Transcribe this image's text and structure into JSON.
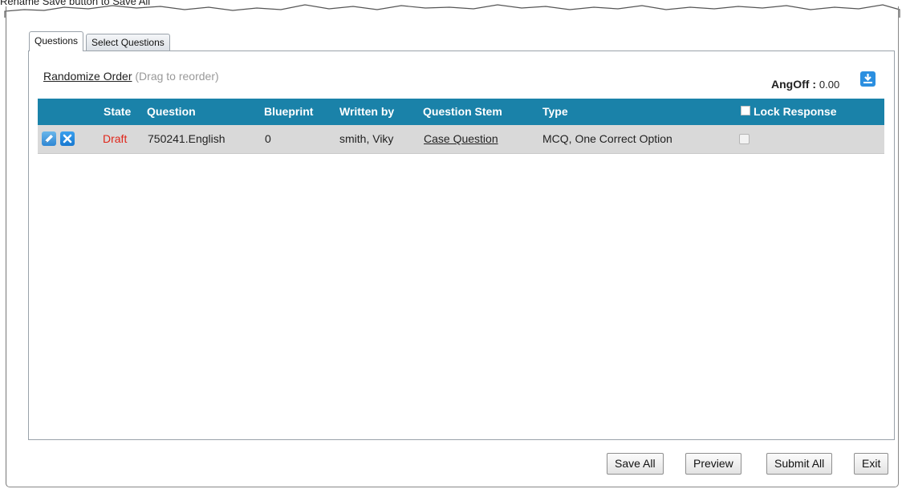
{
  "caption": "Rename Save button to Save All",
  "tabs": [
    {
      "label": "Questions",
      "active": true
    },
    {
      "label": "Select Questions",
      "active": false
    }
  ],
  "toolbar": {
    "randomize_label": "Randomize Order",
    "randomize_hint": "(Drag to reorder)",
    "angoff_label": "AngOff :",
    "angoff_value": "0.00"
  },
  "grid": {
    "columns": {
      "state": "State",
      "question": "Question",
      "blueprint": "Blueprint",
      "written_by": "Written by",
      "question_stem": "Question Stem",
      "type": "Type",
      "lock_response": "Lock Response"
    },
    "rows": [
      {
        "state": "Draft",
        "question": "750241.English",
        "blueprint": "0",
        "written_by": "smith, Viky",
        "question_stem": "Case Question",
        "type": "MCQ, One Correct Option",
        "lock_response": false
      }
    ]
  },
  "footer": {
    "save_all": "Save All",
    "preview": "Preview",
    "submit_all": "Submit All",
    "exit": "Exit"
  },
  "colors": {
    "header_bg": "#1a82a9",
    "row_bg": "#d9d9d9",
    "draft_state": "#e0261a",
    "icon_blue": "#2b8fe0"
  },
  "icons": {
    "edit": "pencil-edit-icon",
    "delete": "close-icon",
    "download": "download-icon"
  }
}
